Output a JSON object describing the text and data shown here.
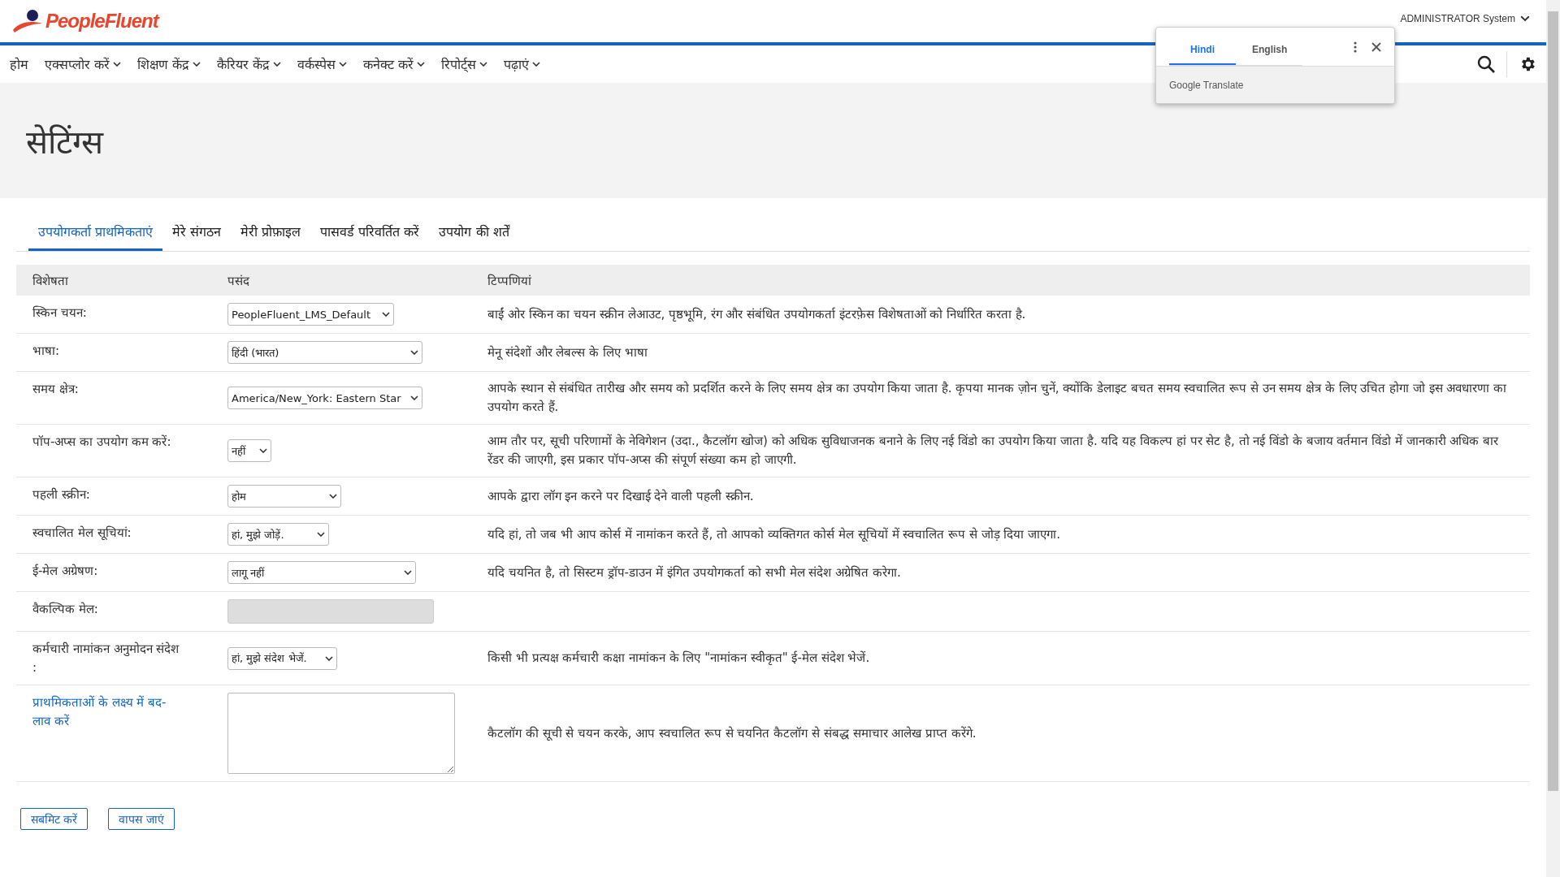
{
  "header": {
    "logo": "PeopleFluent",
    "user_menu": "ADMINISTRATOR System"
  },
  "nav": [
    {
      "label": "होम",
      "dropdown": false
    },
    {
      "label": "एक्सप्लोर करें",
      "dropdown": true
    },
    {
      "label": "शिक्षण केंद्र",
      "dropdown": true
    },
    {
      "label": "कैरियर केंद्र",
      "dropdown": true
    },
    {
      "label": "वर्कस्पेस",
      "dropdown": true
    },
    {
      "label": "कनेक्ट करें",
      "dropdown": true
    },
    {
      "label": "रिपोर्ट्स",
      "dropdown": true
    },
    {
      "label": "पढ़ाएं",
      "dropdown": true
    }
  ],
  "translate_popup": {
    "tabs": [
      {
        "label": "Hindi",
        "selected": true
      },
      {
        "label": "English",
        "selected": false
      }
    ],
    "footer": "Google Translate"
  },
  "page_title": "सेटिंग्स",
  "tabs": [
    {
      "label": "उपयोगकर्ता प्राथमिकताएं",
      "selected": true
    },
    {
      "label": "मेरे संगठन",
      "selected": false
    },
    {
      "label": "मेरी प्रोफ़ाइल",
      "selected": false
    },
    {
      "label": "पासवर्ड परिवर्तित करें",
      "selected": false
    },
    {
      "label": "उपयोग की शर्तें",
      "selected": false
    }
  ],
  "table": {
    "columns": [
      "विशेषता",
      "पसंद",
      "टिप्पणियां"
    ],
    "rows": [
      {
        "kind": "select",
        "label": "स्किन चयन:",
        "value": "PeopleFluent_LMS_Default",
        "note": "बाईं ओर स्किन का चयन स्क्रीन लेआउट, पृष्ठभूमि, रंग और संबंधित उपयोगकर्ता इंटरफ़ेस विशेषताओं को निर्धारित करता है."
      },
      {
        "kind": "select",
        "label": "भाषा:",
        "value": "हिंदी (भारत)",
        "note": "मेनू संदेशों और लेबल्स के लिए भाषा"
      },
      {
        "kind": "select",
        "label": "समय क्षेत्र:",
        "value": "America/New_York: Eastern Star",
        "note": "आपके स्थान से संबंधित तारीख और समय को प्रदर्शित करने के लिए समय क्षेत्र का उपयोग किया जाता है. कृपया मानक ज़ोन चुनें, क्योंकि डेलाइट बचत समय स्वचालित रूप से उन समय क्षेत्र के लिए उचित होगा जो इस अवधारणा का उपयोग करते हैं."
      },
      {
        "kind": "select",
        "label": "पॉप-अप्स का उपयोग कम करें:",
        "value": "नहीं",
        "note": "आम तौर पर, सूची परिणामों के नेविगेशन (उदा., कैटलॉग खोज) को अधिक सुविधाजनक बनाने के लिए नई विंडो का उपयोग किया जाता है. यदि यह विकल्प हां पर सेट है, तो नई विंडो के बजाय वर्तमान विंडो में जानकारी अधिक बार रेंडर की जाएगी, इस प्रकार पॉप-अप्स की संपूर्ण संख्या कम हो जाएगी."
      },
      {
        "kind": "select",
        "label": "पहली स्क्रीन:",
        "value": "होम",
        "note": "आपके द्वारा लॉग इन करने पर दिखाई देने वाली पहली स्क्रीन."
      },
      {
        "kind": "select",
        "label": "स्वचालित मेल सूचियां:",
        "value": "हां, मुझे जोड़ें.",
        "note": "यदि हां, तो जब भी आप कोर्स में नामांकन करते हैं, तो आपको व्यक्तिगत कोर्स मेल सूचियों में स्वचालित रूप से जोड़ दिया जाएगा."
      },
      {
        "kind": "select",
        "label": "ई-मेल अग्रेषण:",
        "value": "लागू नहीं",
        "note": "यदि चयनित है, तो सिस्टम ड्रॉप-डाउन में इंगित उपयोगकर्ता को सभी मेल संदेश अग्रेषित करेगा."
      },
      {
        "kind": "field",
        "label": "वैकल्पिक मेल:",
        "disabled": true
      },
      {
        "kind": "select",
        "label": "कर्मचारी नामांकन अनुमोदन संदेश",
        "label_suffix": ":",
        "value": "हां, मुझे संदेश भेजें.",
        "note": "किसी भी प्रत्यक्ष कर्मचारी कक्षा नामांकन के लिए \"नामांकन स्वीकृत\" ई-मेल संदेश भेजें."
      },
      {
        "kind": "textarea",
        "label": "प्राथमिकताओं के लक्ष्य में बद-लाव करें",
        "label_link": true,
        "note": "कैटलॉग की सूची से चयन करके, आप स्वचालित रूप से चयनित कैटलॉग से संबद्ध समाचार आलेख प्राप्त करेंगे."
      }
    ]
  },
  "buttons": [
    "सबमिट करें",
    "वापस जाएं"
  ]
}
